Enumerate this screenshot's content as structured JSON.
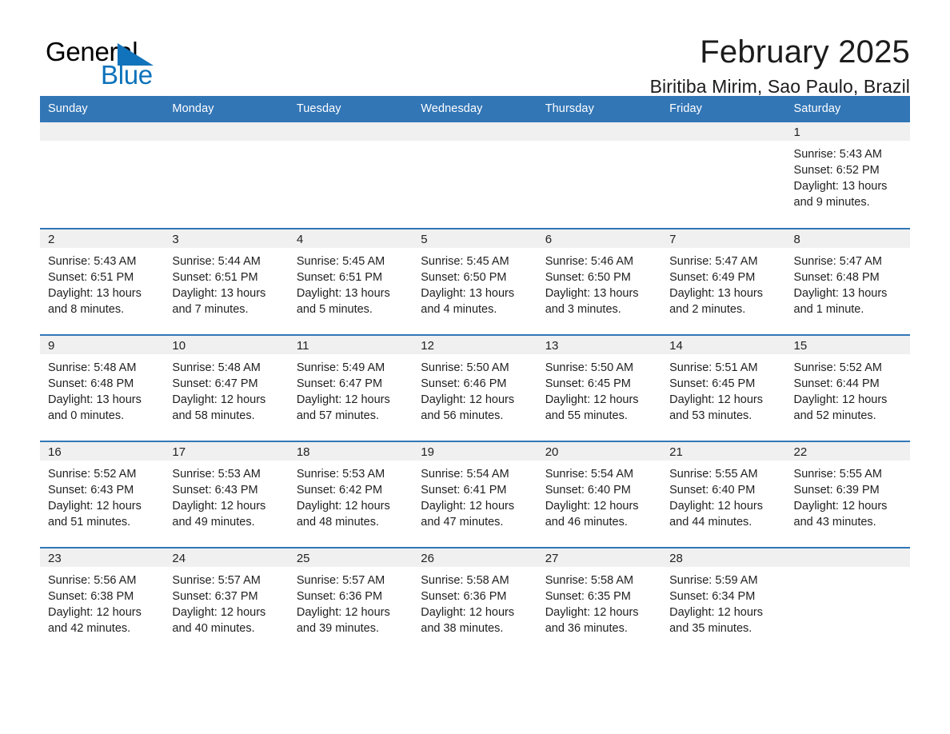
{
  "brand": {
    "word_one": "General",
    "word_two": "Blue",
    "logo_icon": "triangle-logo-icon",
    "accent_color": "#1173bb"
  },
  "header": {
    "month_title": "February 2025",
    "location": "Biritiba Mirim, Sao Paulo, Brazil"
  },
  "theme": {
    "header_band": "#3276b6",
    "daynum_band": "#f0f0f0",
    "text": "#1f1f1f"
  },
  "calendar": {
    "weekday_headers": [
      "Sunday",
      "Monday",
      "Tuesday",
      "Wednesday",
      "Thursday",
      "Friday",
      "Saturday"
    ],
    "labels": {
      "sunrise": "Sunrise:",
      "sunset": "Sunset:",
      "daylight": "Daylight:"
    },
    "weeks": [
      [
        {
          "day": "",
          "empty": true
        },
        {
          "day": "",
          "empty": true
        },
        {
          "day": "",
          "empty": true
        },
        {
          "day": "",
          "empty": true
        },
        {
          "day": "",
          "empty": true
        },
        {
          "day": "",
          "empty": true
        },
        {
          "day": "1",
          "sunrise": "Sunrise: 5:43 AM",
          "sunset": "Sunset: 6:52 PM",
          "daylight": "Daylight: 13 hours and 9 minutes."
        }
      ],
      [
        {
          "day": "2",
          "sunrise": "Sunrise: 5:43 AM",
          "sunset": "Sunset: 6:51 PM",
          "daylight": "Daylight: 13 hours and 8 minutes."
        },
        {
          "day": "3",
          "sunrise": "Sunrise: 5:44 AM",
          "sunset": "Sunset: 6:51 PM",
          "daylight": "Daylight: 13 hours and 7 minutes."
        },
        {
          "day": "4",
          "sunrise": "Sunrise: 5:45 AM",
          "sunset": "Sunset: 6:51 PM",
          "daylight": "Daylight: 13 hours and 5 minutes."
        },
        {
          "day": "5",
          "sunrise": "Sunrise: 5:45 AM",
          "sunset": "Sunset: 6:50 PM",
          "daylight": "Daylight: 13 hours and 4 minutes."
        },
        {
          "day": "6",
          "sunrise": "Sunrise: 5:46 AM",
          "sunset": "Sunset: 6:50 PM",
          "daylight": "Daylight: 13 hours and 3 minutes."
        },
        {
          "day": "7",
          "sunrise": "Sunrise: 5:47 AM",
          "sunset": "Sunset: 6:49 PM",
          "daylight": "Daylight: 13 hours and 2 minutes."
        },
        {
          "day": "8",
          "sunrise": "Sunrise: 5:47 AM",
          "sunset": "Sunset: 6:48 PM",
          "daylight": "Daylight: 13 hours and 1 minute."
        }
      ],
      [
        {
          "day": "9",
          "sunrise": "Sunrise: 5:48 AM",
          "sunset": "Sunset: 6:48 PM",
          "daylight": "Daylight: 13 hours and 0 minutes."
        },
        {
          "day": "10",
          "sunrise": "Sunrise: 5:48 AM",
          "sunset": "Sunset: 6:47 PM",
          "daylight": "Daylight: 12 hours and 58 minutes."
        },
        {
          "day": "11",
          "sunrise": "Sunrise: 5:49 AM",
          "sunset": "Sunset: 6:47 PM",
          "daylight": "Daylight: 12 hours and 57 minutes."
        },
        {
          "day": "12",
          "sunrise": "Sunrise: 5:50 AM",
          "sunset": "Sunset: 6:46 PM",
          "daylight": "Daylight: 12 hours and 56 minutes."
        },
        {
          "day": "13",
          "sunrise": "Sunrise: 5:50 AM",
          "sunset": "Sunset: 6:45 PM",
          "daylight": "Daylight: 12 hours and 55 minutes."
        },
        {
          "day": "14",
          "sunrise": "Sunrise: 5:51 AM",
          "sunset": "Sunset: 6:45 PM",
          "daylight": "Daylight: 12 hours and 53 minutes."
        },
        {
          "day": "15",
          "sunrise": "Sunrise: 5:52 AM",
          "sunset": "Sunset: 6:44 PM",
          "daylight": "Daylight: 12 hours and 52 minutes."
        }
      ],
      [
        {
          "day": "16",
          "sunrise": "Sunrise: 5:52 AM",
          "sunset": "Sunset: 6:43 PM",
          "daylight": "Daylight: 12 hours and 51 minutes."
        },
        {
          "day": "17",
          "sunrise": "Sunrise: 5:53 AM",
          "sunset": "Sunset: 6:43 PM",
          "daylight": "Daylight: 12 hours and 49 minutes."
        },
        {
          "day": "18",
          "sunrise": "Sunrise: 5:53 AM",
          "sunset": "Sunset: 6:42 PM",
          "daylight": "Daylight: 12 hours and 48 minutes."
        },
        {
          "day": "19",
          "sunrise": "Sunrise: 5:54 AM",
          "sunset": "Sunset: 6:41 PM",
          "daylight": "Daylight: 12 hours and 47 minutes."
        },
        {
          "day": "20",
          "sunrise": "Sunrise: 5:54 AM",
          "sunset": "Sunset: 6:40 PM",
          "daylight": "Daylight: 12 hours and 46 minutes."
        },
        {
          "day": "21",
          "sunrise": "Sunrise: 5:55 AM",
          "sunset": "Sunset: 6:40 PM",
          "daylight": "Daylight: 12 hours and 44 minutes."
        },
        {
          "day": "22",
          "sunrise": "Sunrise: 5:55 AM",
          "sunset": "Sunset: 6:39 PM",
          "daylight": "Daylight: 12 hours and 43 minutes."
        }
      ],
      [
        {
          "day": "23",
          "sunrise": "Sunrise: 5:56 AM",
          "sunset": "Sunset: 6:38 PM",
          "daylight": "Daylight: 12 hours and 42 minutes."
        },
        {
          "day": "24",
          "sunrise": "Sunrise: 5:57 AM",
          "sunset": "Sunset: 6:37 PM",
          "daylight": "Daylight: 12 hours and 40 minutes."
        },
        {
          "day": "25",
          "sunrise": "Sunrise: 5:57 AM",
          "sunset": "Sunset: 6:36 PM",
          "daylight": "Daylight: 12 hours and 39 minutes."
        },
        {
          "day": "26",
          "sunrise": "Sunrise: 5:58 AM",
          "sunset": "Sunset: 6:36 PM",
          "daylight": "Daylight: 12 hours and 38 minutes."
        },
        {
          "day": "27",
          "sunrise": "Sunrise: 5:58 AM",
          "sunset": "Sunset: 6:35 PM",
          "daylight": "Daylight: 12 hours and 36 minutes."
        },
        {
          "day": "28",
          "sunrise": "Sunrise: 5:59 AM",
          "sunset": "Sunset: 6:34 PM",
          "daylight": "Daylight: 12 hours and 35 minutes."
        },
        {
          "day": "",
          "empty": true
        }
      ]
    ]
  }
}
